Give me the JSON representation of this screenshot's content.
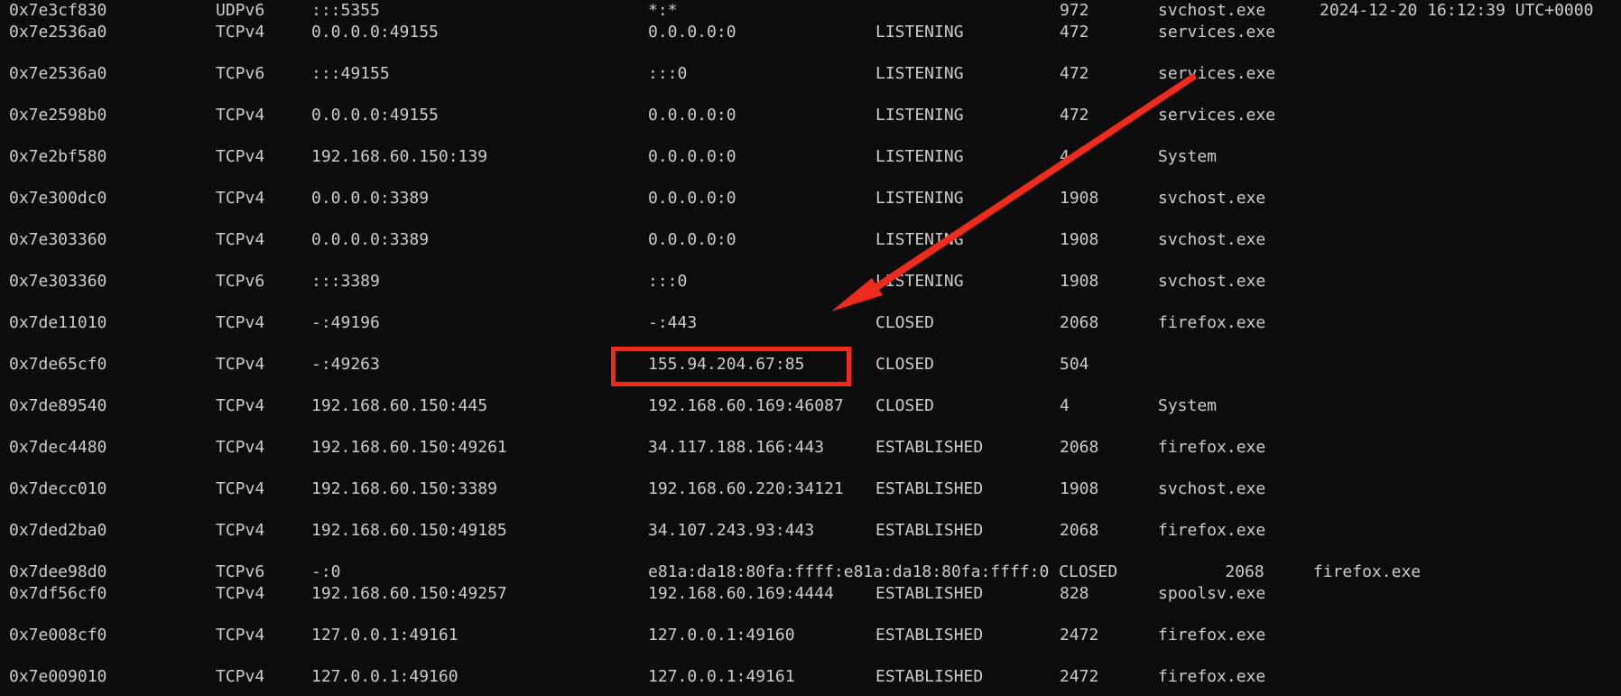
{
  "colors": {
    "background": "#0c0c0c",
    "text": "#cccccc",
    "annotation": "#ee2b1c"
  },
  "rows": [
    {
      "offset": "0x7e3cf830",
      "proto": "UDPv6",
      "local": ":::5355",
      "foreign": "*:*",
      "state": "",
      "pid": "972",
      "owner": "svchost.exe",
      "created": "2024-12-20 16:12:39 UTC+0000"
    },
    {
      "offset": "0x7e2536a0",
      "proto": "TCPv4",
      "local": "0.0.0.0:49155",
      "foreign": "0.0.0.0:0",
      "state": "LISTENING",
      "pid": "472",
      "owner": "services.exe",
      "created": ""
    },
    {
      "offset": "0x7e2536a0",
      "proto": "TCPv6",
      "local": ":::49155",
      "foreign": ":::0",
      "state": "LISTENING",
      "pid": "472",
      "owner": "services.exe",
      "created": ""
    },
    {
      "offset": "0x7e2598b0",
      "proto": "TCPv4",
      "local": "0.0.0.0:49155",
      "foreign": "0.0.0.0:0",
      "state": "LISTENING",
      "pid": "472",
      "owner": "services.exe",
      "created": ""
    },
    {
      "offset": "0x7e2bf580",
      "proto": "TCPv4",
      "local": "192.168.60.150:139",
      "foreign": "0.0.0.0:0",
      "state": "LISTENING",
      "pid": "4",
      "owner": "System",
      "created": ""
    },
    {
      "offset": "0x7e300dc0",
      "proto": "TCPv4",
      "local": "0.0.0.0:3389",
      "foreign": "0.0.0.0:0",
      "state": "LISTENING",
      "pid": "1908",
      "owner": "svchost.exe",
      "created": ""
    },
    {
      "offset": "0x7e303360",
      "proto": "TCPv4",
      "local": "0.0.0.0:3389",
      "foreign": "0.0.0.0:0",
      "state": "LISTENING",
      "pid": "1908",
      "owner": "svchost.exe",
      "created": ""
    },
    {
      "offset": "0x7e303360",
      "proto": "TCPv6",
      "local": ":::3389",
      "foreign": ":::0",
      "state": "LISTENING",
      "pid": "1908",
      "owner": "svchost.exe",
      "created": ""
    },
    {
      "offset": "0x7de11010",
      "proto": "TCPv4",
      "local": "-:49196",
      "foreign": "-:443",
      "state": "CLOSED",
      "pid": "2068",
      "owner": "firefox.exe",
      "created": ""
    },
    {
      "offset": "0x7de65cf0",
      "proto": "TCPv4",
      "local": "-:49263",
      "foreign": "155.94.204.67:85",
      "state": "CLOSED",
      "pid": "504",
      "owner": "",
      "created": ""
    },
    {
      "offset": "0x7de89540",
      "proto": "TCPv4",
      "local": "192.168.60.150:445",
      "foreign": "192.168.60.169:46087",
      "state": "CLOSED",
      "pid": "4",
      "owner": "System",
      "created": ""
    },
    {
      "offset": "0x7dec4480",
      "proto": "TCPv4",
      "local": "192.168.60.150:49261",
      "foreign": "34.117.188.166:443",
      "state": "ESTABLISHED",
      "pid": "2068",
      "owner": "firefox.exe",
      "created": ""
    },
    {
      "offset": "0x7decc010",
      "proto": "TCPv4",
      "local": "192.168.60.150:3389",
      "foreign": "192.168.60.220:34121",
      "state": "ESTABLISHED",
      "pid": "1908",
      "owner": "svchost.exe",
      "created": ""
    },
    {
      "offset": "0x7ded2ba0",
      "proto": "TCPv4",
      "local": "192.168.60.150:49185",
      "foreign": "34.107.243.93:443",
      "state": "ESTABLISHED",
      "pid": "2068",
      "owner": "firefox.exe",
      "created": ""
    },
    {
      "offset": "0x7dee98d0",
      "proto": "TCPv6",
      "local": "-:0",
      "foreign": "e81a:da18:80fa:ffff:e81a:da18:80fa:ffff:0 CLOSED           2068     firefox.exe",
      "state": "",
      "pid": "",
      "owner": "",
      "created": ""
    },
    {
      "offset": "0x7df56cf0",
      "proto": "TCPv4",
      "local": "192.168.60.150:49257",
      "foreign": "192.168.60.169:4444",
      "state": "ESTABLISHED",
      "pid": "828",
      "owner": "spoolsv.exe",
      "created": ""
    },
    {
      "offset": "0x7e008cf0",
      "proto": "TCPv4",
      "local": "127.0.0.1:49161",
      "foreign": "127.0.0.1:49160",
      "state": "ESTABLISHED",
      "pid": "2472",
      "owner": "firefox.exe",
      "created": ""
    },
    {
      "offset": "0x7e009010",
      "proto": "TCPv4",
      "local": "127.0.0.1:49160",
      "foreign": "127.0.0.1:49161",
      "state": "ESTABLISHED",
      "pid": "2472",
      "owner": "firefox.exe",
      "created": ""
    }
  ],
  "annotation": {
    "arrow_icon": "red-arrow",
    "box_icon": "red-highlight-box"
  }
}
